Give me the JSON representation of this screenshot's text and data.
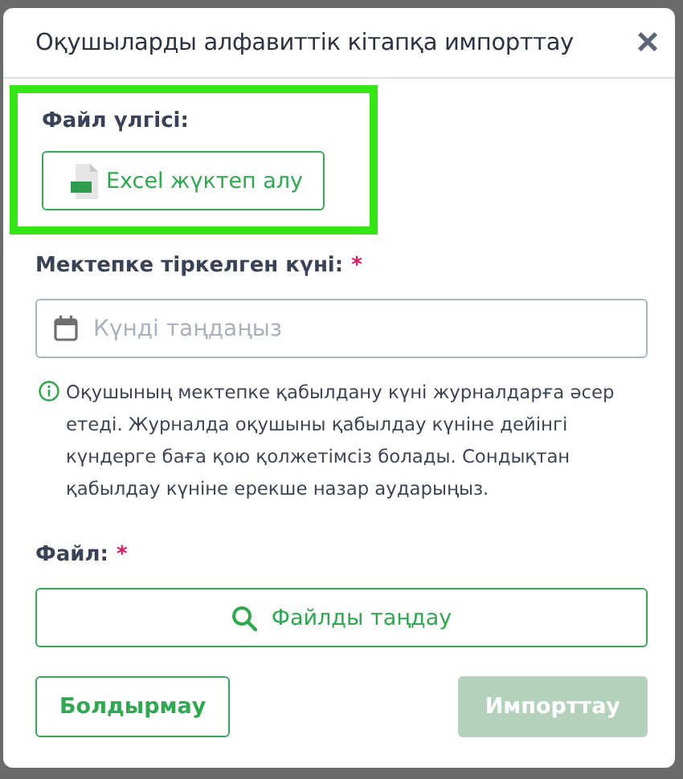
{
  "dialog": {
    "title": "Оқушыларды алфавиттік кітапқа импорттау",
    "close": "×"
  },
  "template": {
    "highlighted": true,
    "label": "Файл үлгісі:",
    "button": "Excel жүктеп алу"
  },
  "date_field": {
    "label": "Мектепке тіркелген күні:",
    "required_mark": "*",
    "placeholder": "Күнді таңдаңыз"
  },
  "hint": "Оқушының мектепке қабылдану күні журналдарға әсер етеді. Журналда оқушыны қабылдау күніне дейінгі күндерге баға қою қолжетімсіз болады. Сондықтан қабылдау күніне ерекше назар аударыңыз.",
  "file_field": {
    "label": "Файл:",
    "required_mark": "*",
    "button": "Файлды таңдау"
  },
  "buttons": [
    {
      "label": "Болдырмау",
      "kind": "secondary",
      "disabled": false
    },
    {
      "label": "Импорттау",
      "kind": "primary",
      "disabled": true
    }
  ]
}
